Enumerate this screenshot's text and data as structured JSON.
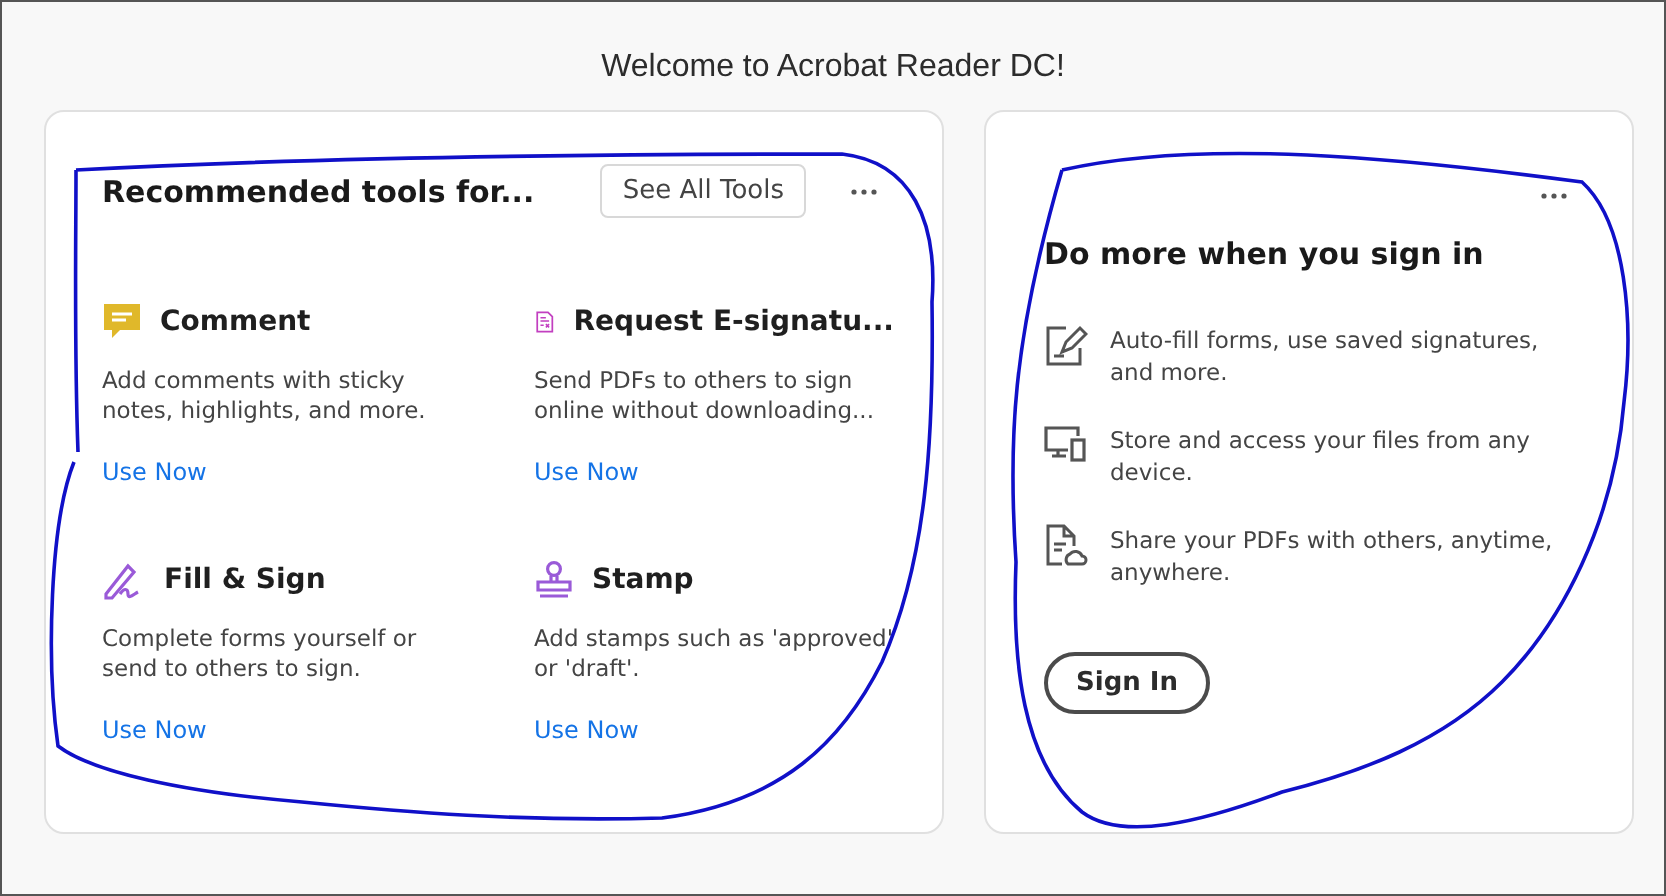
{
  "window": {
    "title": "Welcome to Acrobat Reader DC!"
  },
  "tools_card": {
    "title": "Recommended tools for...",
    "see_all_button": "See All Tools",
    "tools": [
      {
        "kind": "comment",
        "color": "#e0b82a",
        "name": "Comment",
        "description": "Add comments with sticky notes, highlights, and more.",
        "link": "Use Now"
      },
      {
        "kind": "esign",
        "color": "#c23fc0",
        "name": "Request E-signatu...",
        "description": "Send PDFs to others to sign online without downloading...",
        "link": "Use Now"
      },
      {
        "kind": "fill-sign",
        "color": "#9a5ad8",
        "name": "Fill & Sign",
        "description": "Complete forms yourself or send to others to sign.",
        "link": "Use Now"
      },
      {
        "kind": "stamp",
        "color": "#9a5ad8",
        "name": "Stamp",
        "description": "Add stamps such as 'approved' or 'draft'.",
        "link": "Use Now"
      }
    ]
  },
  "signin_card": {
    "title": "Do more when you sign in",
    "benefits": [
      {
        "kind": "fill",
        "text": "Auto-fill forms, use saved signatures, and more."
      },
      {
        "kind": "devices",
        "text": "Store and access your files from any device."
      },
      {
        "kind": "share",
        "text": "Share your PDFs with others, anytime, anywhere."
      }
    ],
    "sign_in_button": "Sign In"
  }
}
